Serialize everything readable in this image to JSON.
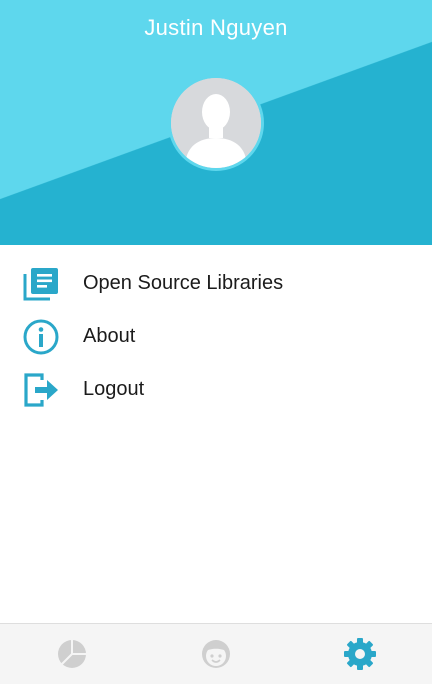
{
  "header": {
    "user_name": "Justin Nguyen",
    "avatar_icon": "default-person-silhouette",
    "colors": {
      "light": "#5ed7ed",
      "dark": "#25b2d0"
    }
  },
  "menu": {
    "items": [
      {
        "label": "Open Source Libraries",
        "icon": "library-books-icon"
      },
      {
        "label": "About",
        "icon": "info-icon"
      },
      {
        "label": "Logout",
        "icon": "logout-icon"
      }
    ],
    "icon_color": "#2aa7c9"
  },
  "bottom_nav": {
    "tabs": [
      {
        "icon": "pie-chart-icon",
        "active": false
      },
      {
        "icon": "face-icon",
        "active": false
      },
      {
        "icon": "settings-gear-icon",
        "active": true
      }
    ],
    "active_color": "#2aa7c9",
    "inactive_color": "#cfcfcf"
  }
}
